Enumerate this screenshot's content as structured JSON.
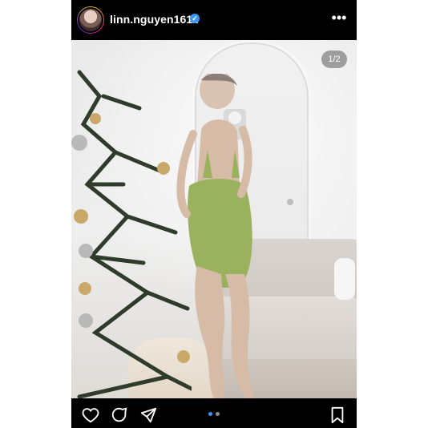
{
  "post": {
    "username": "linn.nguyen1611",
    "verified_icon": "verified-badge-icon",
    "more_icon": "more-options-icon",
    "carousel_counter": "1/2",
    "carousel_position": 1,
    "carousel_total": 2
  },
  "actions": {
    "like_icon": "heart-icon",
    "comment_icon": "comment-icon",
    "share_icon": "send-icon",
    "save_icon": "bookmark-icon"
  },
  "colors": {
    "background": "#000000",
    "text": "#ffffff",
    "verified": "#3897f0",
    "dot_active": "#3897f0",
    "dot_inactive": "#8e8e8e"
  }
}
